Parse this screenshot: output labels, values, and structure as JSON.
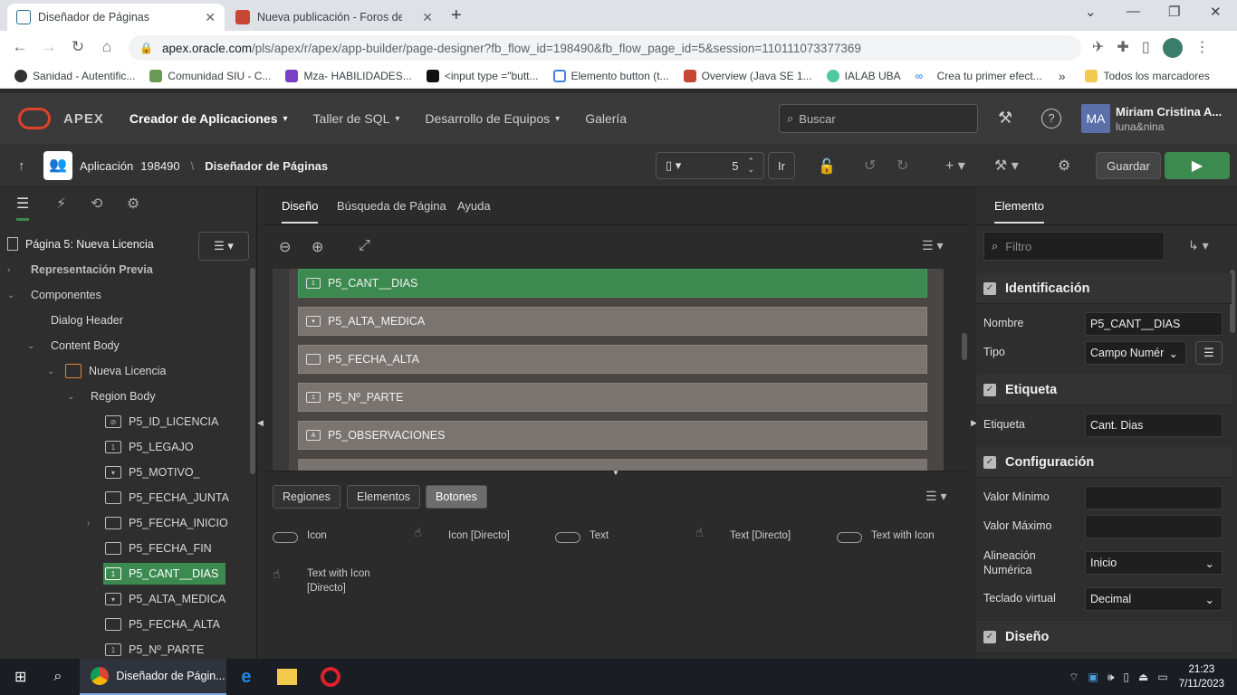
{
  "browser": {
    "tabs": [
      {
        "title": "Diseñador de Páginas",
        "active": true
      },
      {
        "title": "Nueva publicación - Foros de Or",
        "active": false
      }
    ],
    "url_host": "apex.oracle.com",
    "url_rest": "/pls/apex/r/apex/app-builder/page-designer?fb_flow_id=198490&fb_flow_page_id=5&session=110111073377369",
    "bookmarks": [
      "Sanidad - Autentific...",
      "Comunidad SIU - C...",
      "Mza- HABILIDADES...",
      "<input type =\"butt...",
      "Elemento button (t...",
      "Overview (Java SE 1...",
      "IALAB UBA",
      "Crea tu primer efect..."
    ],
    "bookmarks_folder": "Todos los marcadores"
  },
  "apex": {
    "logo": "APEX",
    "menus": [
      "Creador de Aplicaciones",
      "Taller de SQL",
      "Desarrollo de Equipos",
      "Galería"
    ],
    "search_placeholder": "Buscar",
    "user_initials": "MA",
    "user_name": "Miriam Cristina A...",
    "user_workspace": "luna&nina"
  },
  "toolbar": {
    "app_label": "Aplicación",
    "app_id": "198490",
    "breadcrumb": "Diseñador de Páginas",
    "page_number": "5",
    "go_label": "Ir",
    "save_label": "Guardar"
  },
  "left": {
    "page_title": "Página 5: Nueva Licencia",
    "tree": [
      {
        "label": "Representación Previa"
      },
      {
        "label": "Componentes"
      },
      {
        "label": "Dialog Header"
      },
      {
        "label": "Content Body"
      },
      {
        "label": "Nueva Licencia"
      },
      {
        "label": "Region Body"
      },
      {
        "label": "P5_ID_LICENCIA"
      },
      {
        "label": "P5_LEGAJO"
      },
      {
        "label": "P5_MOTIVO_"
      },
      {
        "label": "P5_FECHA_JUNTA"
      },
      {
        "label": "P5_FECHA_INICIO"
      },
      {
        "label": "P5_FECHA_FIN"
      },
      {
        "label": "P5_CANT__DIAS"
      },
      {
        "label": "P5_ALTA_MEDICA"
      },
      {
        "label": "P5_FECHA_ALTA"
      },
      {
        "label": "P5_Nº_PARTE"
      }
    ]
  },
  "center": {
    "tabs": [
      "Diseño",
      "Búsqueda de Página",
      "Ayuda"
    ],
    "items": [
      {
        "label": "P5_CANT__DIAS",
        "icon": "number-field-icon"
      },
      {
        "label": "P5_ALTA_MEDICA",
        "icon": "select-list-icon"
      },
      {
        "label": "P5_FECHA_ALTA",
        "icon": "calendar-icon"
      },
      {
        "label": "P5_Nº_PARTE",
        "icon": "number-field-icon"
      },
      {
        "label": "P5_OBSERVACIONES",
        "icon": "textarea-icon"
      }
    ],
    "gallery_tabs": [
      "Regiones",
      "Elementos",
      "Botones"
    ],
    "gallery_items": [
      {
        "label": "Icon",
        "kind": "pill"
      },
      {
        "label": "Icon [Directo]",
        "kind": "hand"
      },
      {
        "label": "Text",
        "kind": "pill"
      },
      {
        "label": "Text [Directo]",
        "kind": "hand"
      },
      {
        "label": "Text with Icon",
        "kind": "pill"
      },
      {
        "label": "Text with Icon [Directo]",
        "kind": "hand"
      }
    ]
  },
  "right": {
    "tab": "Elemento",
    "filter_placeholder": "Filtro",
    "sections": {
      "identificacion": "Identificación",
      "etiqueta": "Etiqueta",
      "configuracion": "Configuración",
      "diseno": "Diseño"
    },
    "props": {
      "nombre_label": "Nombre",
      "nombre_value": "P5_CANT__DIAS",
      "tipo_label": "Tipo",
      "tipo_value": "Campo Numér",
      "etiqueta_label": "Etiqueta",
      "etiqueta_value": "Cant. Dias",
      "valmin_label": "Valor Mínimo",
      "valmin_value": "",
      "valmax_label": "Valor Máximo",
      "valmax_value": "",
      "alineacion_label": "Alineación Numérica",
      "alineacion_value": "Inicio",
      "teclado_label": "Teclado virtual",
      "teclado_value": "Decimal"
    }
  },
  "taskbar": {
    "active_app": "Diseñador de Págin...",
    "time": "21:23",
    "date": "7/11/2023"
  },
  "colors": {
    "accent_green": "#3c8a4f",
    "apex_red": "#e0412b"
  }
}
